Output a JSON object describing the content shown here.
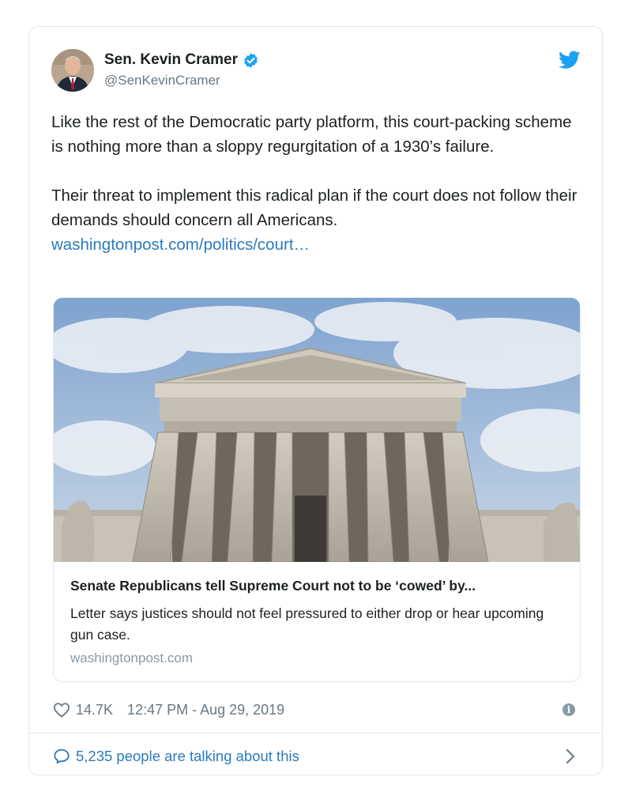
{
  "tweet": {
    "author_name": "Sen. Kevin Cramer",
    "author_handle": "@SenKevinCramer",
    "paragraph1": "Like the rest of the Democratic party platform, this court-packing scheme is nothing more than a sloppy regurgitation of a 1930’s failure.",
    "paragraph2": "Their threat to implement this radical plan if the court does not follow their demands should concern all Americans.",
    "link_text": "washingtonpost.com/politics/court…",
    "icons": {
      "verified": "verified-badge-icon",
      "bird": "twitter-bird-icon",
      "heart": "heart-icon",
      "info": "info-icon",
      "bubble": "speech-bubble-icon",
      "chevron": "chevron-right-icon"
    },
    "colors": {
      "link": "#2b7bb9",
      "verified": "#1da1f2",
      "muted": "#697882"
    }
  },
  "card": {
    "title": "Senate Republicans tell Supreme Court not to be ‘cowed’ by...",
    "description": "Letter says justices should not feel pressured to either drop or hear upcoming gun case.",
    "domain": "washingtonpost.com",
    "image_subject": "Supreme Court building facade with columns under a cloudy sky"
  },
  "meta": {
    "likes": "14.7K",
    "timestamp": "12:47 PM - Aug 29, 2019",
    "info_glyph": "i"
  },
  "footer": {
    "talking_text": "5,235 people are talking about this"
  }
}
